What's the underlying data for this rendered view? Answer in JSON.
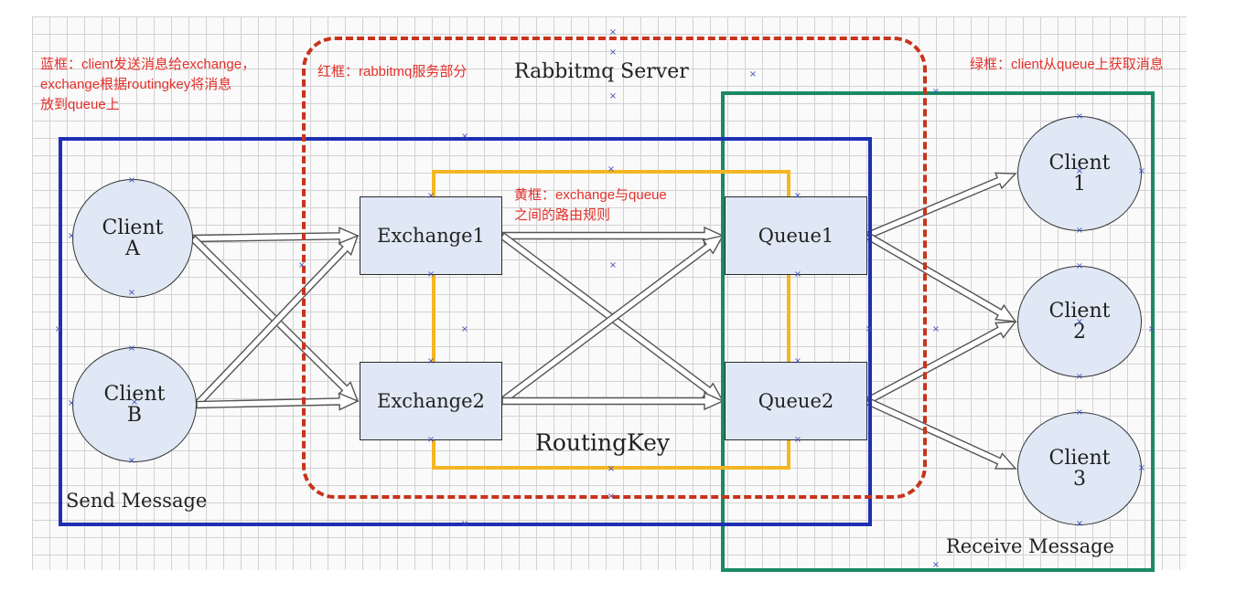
{
  "title": "Rabbitmq Server",
  "notes": {
    "blue": [
      "蓝框：client发送消息给exchange，",
      "exchange根据routingkey将消息",
      "放到queue上"
    ],
    "red": "红框：rabbitmq服务部分",
    "yellow": [
      "黄框：exchange与queue",
      "之间的路由规则"
    ],
    "green": "绿框：client从queue上获取消息"
  },
  "labels": {
    "send": "Send Message",
    "receive": "Receive Message",
    "routing_key": "RoutingKey"
  },
  "senders": [
    {
      "name": "Client",
      "id": "A"
    },
    {
      "name": "Client",
      "id": "B"
    }
  ],
  "exchanges": [
    "Exchange1",
    "Exchange2"
  ],
  "queues": [
    "Queue1",
    "Queue2"
  ],
  "receivers": [
    {
      "name": "Client",
      "id": "1"
    },
    {
      "name": "Client",
      "id": "2"
    },
    {
      "name": "Client",
      "id": "3"
    }
  ],
  "colors": {
    "blue_frame": "#1e2fb4",
    "red_frame": "#c8341c",
    "yellow_frame": "#f4b623",
    "green_frame": "#1a8a63",
    "note_text": "#e2302a",
    "node_fill": "#dfe8f4"
  },
  "edges": [
    {
      "from": "client-a",
      "to": "exchange-1"
    },
    {
      "from": "client-a",
      "to": "exchange-2"
    },
    {
      "from": "client-b",
      "to": "exchange-1"
    },
    {
      "from": "client-b",
      "to": "exchange-2"
    },
    {
      "from": "exchange-1",
      "to": "queue-1"
    },
    {
      "from": "exchange-1",
      "to": "queue-2"
    },
    {
      "from": "exchange-2",
      "to": "queue-1"
    },
    {
      "from": "exchange-2",
      "to": "queue-2"
    },
    {
      "from": "queue-1",
      "to": "client-1"
    },
    {
      "from": "queue-1",
      "to": "client-2"
    },
    {
      "from": "queue-2",
      "to": "client-2"
    },
    {
      "from": "queue-2",
      "to": "client-3"
    }
  ]
}
